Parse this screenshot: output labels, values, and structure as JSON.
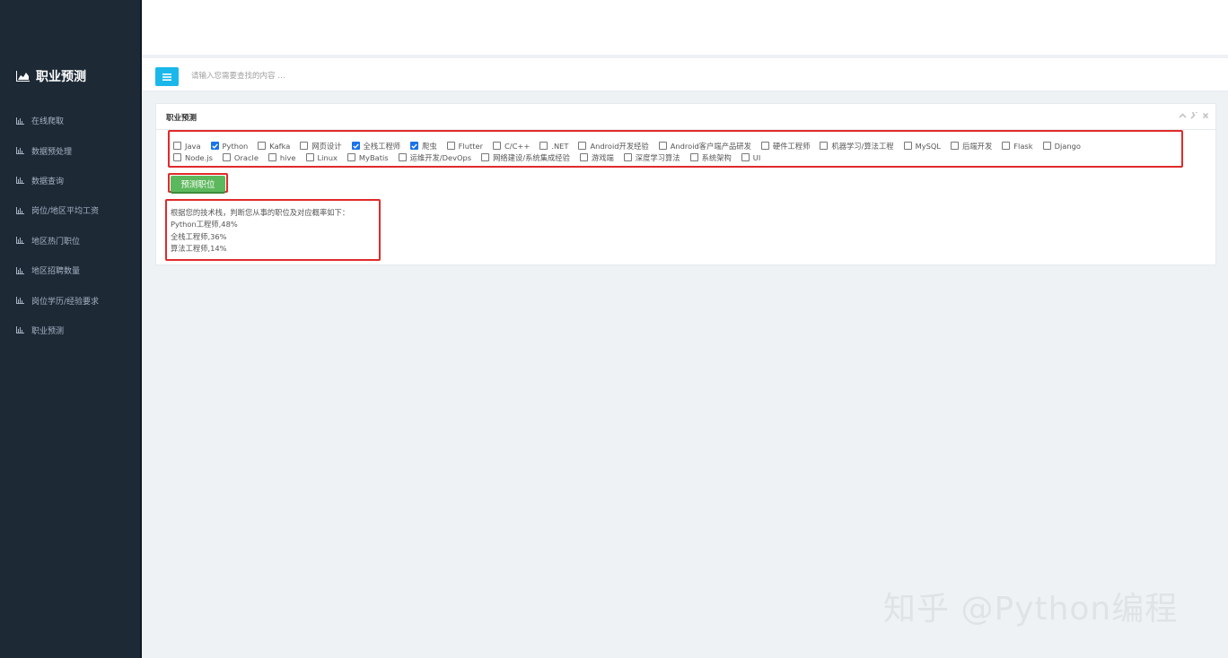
{
  "sidebar": {
    "brand": "职业预测",
    "items": [
      {
        "label": "在线爬取"
      },
      {
        "label": "数据预处理"
      },
      {
        "label": "数据查询"
      },
      {
        "label": "岗位/地区平均工资"
      },
      {
        "label": "地区热门职位"
      },
      {
        "label": "地区招聘数量"
      },
      {
        "label": "岗位学历/经验要求"
      },
      {
        "label": "职业预测"
      }
    ]
  },
  "search": {
    "placeholder": "请输入您需要查找的内容 …"
  },
  "panel": {
    "title": "职业预测",
    "skills_row1": [
      {
        "label": "Java",
        "checked": false
      },
      {
        "label": "Python",
        "checked": true
      },
      {
        "label": "Kafka",
        "checked": false
      },
      {
        "label": "网页设计",
        "checked": false
      },
      {
        "label": "全栈工程师",
        "checked": true
      },
      {
        "label": "爬虫",
        "checked": true
      },
      {
        "label": "Flutter",
        "checked": false
      },
      {
        "label": "C/C++",
        "checked": false
      },
      {
        "label": ".NET",
        "checked": false
      },
      {
        "label": "Android开发经验",
        "checked": false
      },
      {
        "label": "Android客户端产品研发",
        "checked": false
      },
      {
        "label": "硬件工程师",
        "checked": false
      },
      {
        "label": "机器学习/算法工程",
        "checked": false
      },
      {
        "label": "MySQL",
        "checked": false
      },
      {
        "label": "后端开发",
        "checked": false
      },
      {
        "label": "Flask",
        "checked": false
      },
      {
        "label": "Django",
        "checked": false
      }
    ],
    "skills_row2": [
      {
        "label": "Node.js",
        "checked": false
      },
      {
        "label": "Oracle",
        "checked": false
      },
      {
        "label": "hive",
        "checked": false
      },
      {
        "label": "Linux",
        "checked": false
      },
      {
        "label": "MyBatis",
        "checked": false
      },
      {
        "label": "运维开发/DevOps",
        "checked": false
      },
      {
        "label": "网络建设/系统集成经验",
        "checked": false
      },
      {
        "label": "游戏端",
        "checked": false
      },
      {
        "label": "深度学习算法",
        "checked": false
      },
      {
        "label": "系统架构",
        "checked": false
      },
      {
        "label": "UI",
        "checked": false
      }
    ],
    "predict_button": "预测职位",
    "result": {
      "intro": "根据您的技术栈，判断您从事的职位及对应概率如下：",
      "lines": [
        "Python工程师,48%",
        "全栈工程师,36%",
        "算法工程师,14%"
      ]
    }
  },
  "watermark": "知乎 @Python编程",
  "colors": {
    "sidebar_bg": "#1d2a36",
    "accent": "#1ab7ea",
    "button_green": "#5cb85c",
    "highlight_red": "#e02a2a",
    "checkbox_blue": "#1a73e8"
  }
}
